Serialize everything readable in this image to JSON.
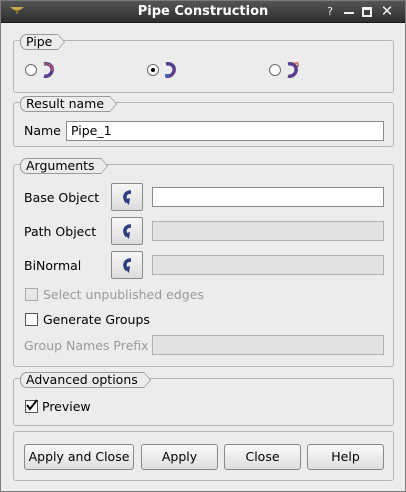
{
  "window": {
    "title": "Pipe Construction",
    "help_glyph": "?",
    "close_glyph": "✕"
  },
  "pipe_group": {
    "label": "Pipe",
    "options": [
      {
        "name": "pipe-variant-1",
        "selected": false
      },
      {
        "name": "pipe-variant-2",
        "selected": true
      },
      {
        "name": "pipe-variant-3",
        "selected": false
      }
    ]
  },
  "result_group": {
    "label": "Result name",
    "name_label": "Name",
    "name_value": "Pipe_1"
  },
  "arguments": {
    "label": "Arguments",
    "base_object_label": "Base Object",
    "path_object_label": "Path Object",
    "binormal_label": "BiNormal",
    "base_object_value": "",
    "path_object_value": "",
    "binormal_value": "",
    "select_unpublished_label": "Select unpublished edges",
    "select_unpublished_checked": false,
    "generate_groups_label": "Generate Groups",
    "generate_groups_checked": false,
    "group_prefix_label": "Group Names Prefix",
    "group_prefix_value": ""
  },
  "advanced": {
    "label": "Advanced options",
    "preview_label": "Preview",
    "preview_checked": true
  },
  "buttons": {
    "apply_close": "Apply and Close",
    "apply": "Apply",
    "close": "Close",
    "help": "Help"
  },
  "colors": {
    "titlebar": "#3a3a3a",
    "dialog_bg": "#ececec",
    "disabled_text": "#9a9a9a"
  }
}
